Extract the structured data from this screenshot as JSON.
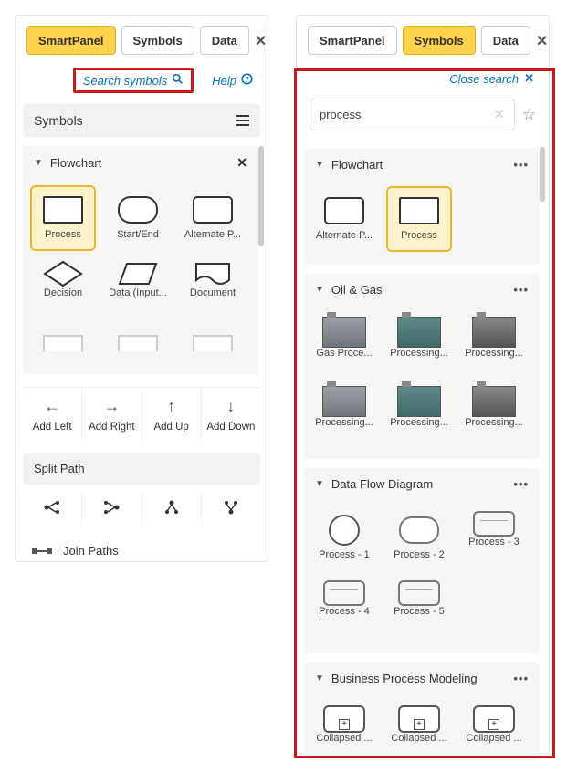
{
  "left": {
    "tabs": [
      "SmartPanel",
      "Symbols",
      "Data"
    ],
    "activeTab": 0,
    "searchLink": "Search symbols",
    "helpLink": "Help",
    "symbolsHeader": "Symbols",
    "flowchart": {
      "title": "Flowchart",
      "items": [
        {
          "label": "Process",
          "selected": true,
          "kind": "rect"
        },
        {
          "label": "Start/End",
          "kind": "round"
        },
        {
          "label": "Alternate P...",
          "kind": "rect"
        },
        {
          "label": "Decision",
          "kind": "diamond"
        },
        {
          "label": "Data (Input...",
          "kind": "para"
        },
        {
          "label": "Document",
          "kind": "doc"
        }
      ]
    },
    "arrows": [
      {
        "label": "Add Left",
        "glyph": "←"
      },
      {
        "label": "Add Right",
        "glyph": "→"
      },
      {
        "label": "Add Up",
        "glyph": "↑"
      },
      {
        "label": "Add Down",
        "glyph": "↓"
      }
    ],
    "splitPathHeader": "Split Path",
    "joinPaths": "Join Paths"
  },
  "right": {
    "tabs": [
      "SmartPanel",
      "Symbols",
      "Data"
    ],
    "activeTab": 1,
    "closeSearch": "Close search",
    "searchValue": "process",
    "categories": [
      {
        "title": "Flowchart",
        "items": [
          {
            "label": "Alternate P...",
            "kind": "rect"
          },
          {
            "label": "Process",
            "selected": true,
            "kind": "rect"
          }
        ]
      },
      {
        "title": "Oil & Gas",
        "items": [
          {
            "label": "Gas Proce...",
            "kind": "ind1"
          },
          {
            "label": "Processing...",
            "kind": "ind2"
          },
          {
            "label": "Processing...",
            "kind": "ind3"
          },
          {
            "label": "Processing...",
            "kind": "ind1"
          },
          {
            "label": "Processing...",
            "kind": "ind2"
          },
          {
            "label": "Processing...",
            "kind": "ind3"
          }
        ]
      },
      {
        "title": "Data Flow Diagram",
        "items": [
          {
            "label": "Process - 1",
            "kind": "circle"
          },
          {
            "label": "Process - 2",
            "kind": "round"
          },
          {
            "label": "Process - 3",
            "kind": "p3"
          },
          {
            "label": "Process - 4",
            "kind": "p3"
          },
          {
            "label": "Process - 5",
            "kind": "p3"
          }
        ]
      },
      {
        "title": "Business Process Modeling",
        "items": [
          {
            "label": "Collapsed ...",
            "kind": "bpm"
          },
          {
            "label": "Collapsed ...",
            "kind": "bpm"
          },
          {
            "label": "Collapsed ...",
            "kind": "bpm"
          }
        ]
      }
    ]
  }
}
